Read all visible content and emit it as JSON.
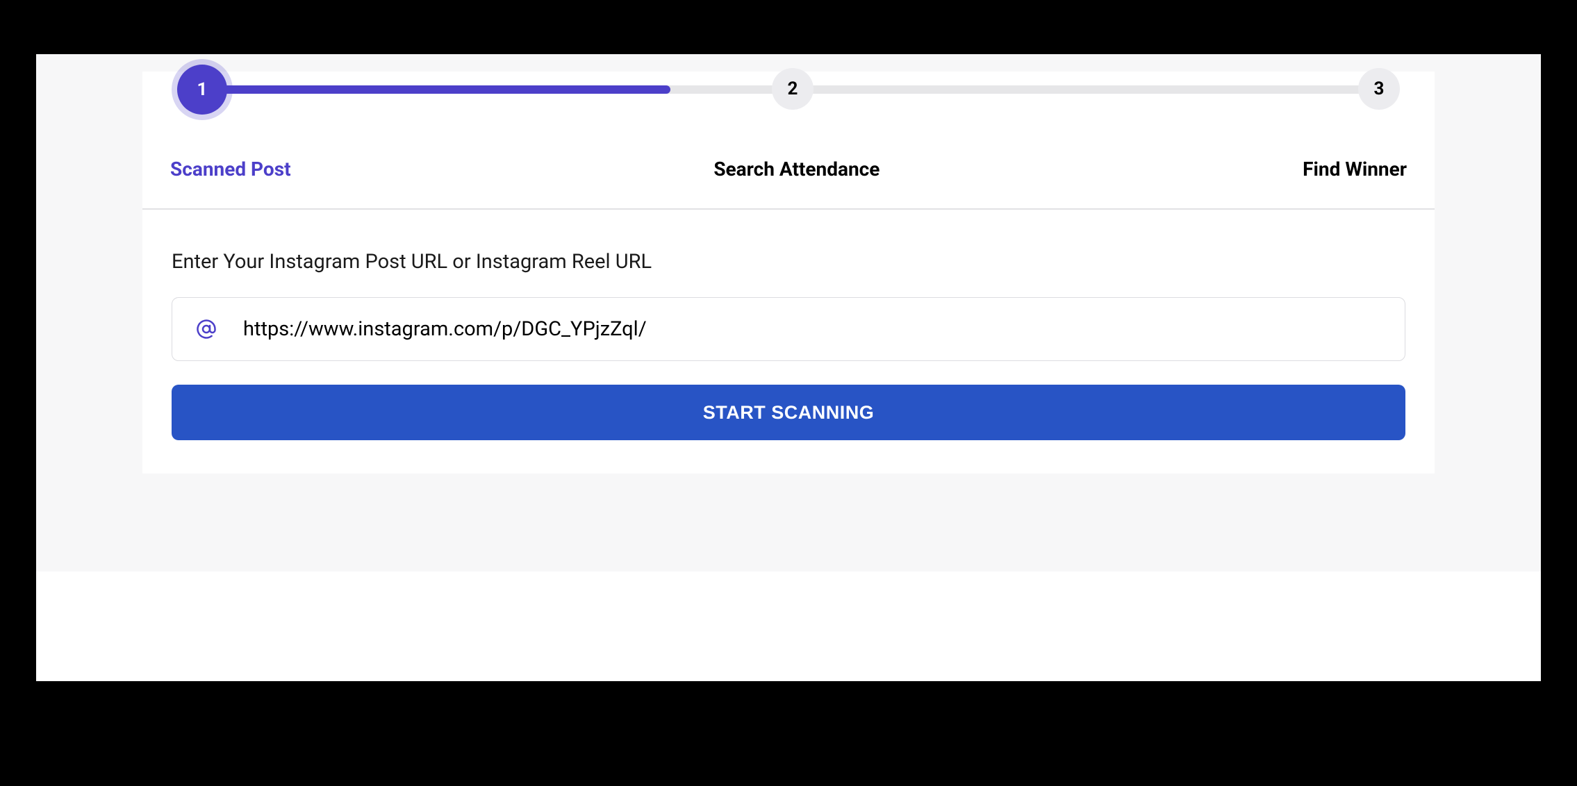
{
  "stepper": {
    "steps": [
      {
        "number": "1",
        "label": "Scanned Post",
        "active": true
      },
      {
        "number": "2",
        "label": "Search Attendance",
        "active": false
      },
      {
        "number": "3",
        "label": "Find Winner",
        "active": false
      }
    ]
  },
  "form": {
    "label": "Enter Your Instagram Post URL or Instagram Reel URL",
    "url_value": "https://www.instagram.com/p/DGC_YPjzZql/",
    "button_label": "START SCANNING"
  }
}
